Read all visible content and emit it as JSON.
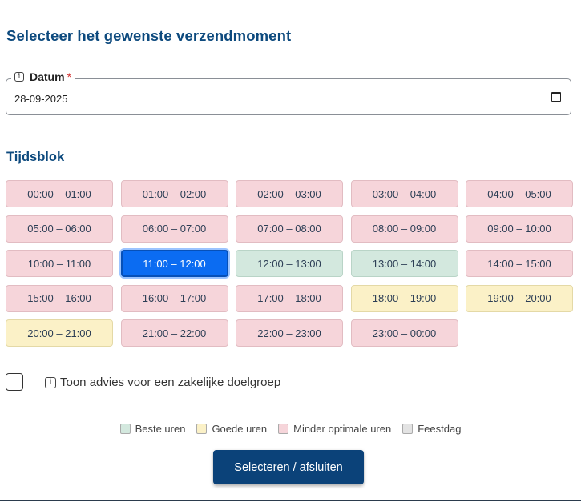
{
  "page_title": "Selecteer het gewenste verzendmoment",
  "date_field": {
    "label": "Datum",
    "required_mark": "*",
    "info_icon": "info-icon",
    "value": "28-09-2025",
    "icon": "calendar-icon"
  },
  "timeblock": {
    "title": "Tijdsblok",
    "slots": [
      {
        "label": "00:00 – 01:00",
        "status": "minder-optimaal"
      },
      {
        "label": "01:00 – 02:00",
        "status": "minder-optimaal"
      },
      {
        "label": "02:00 – 03:00",
        "status": "minder-optimaal"
      },
      {
        "label": "03:00 – 04:00",
        "status": "minder-optimaal"
      },
      {
        "label": "04:00 – 05:00",
        "status": "minder-optimaal"
      },
      {
        "label": "05:00 – 06:00",
        "status": "minder-optimaal"
      },
      {
        "label": "06:00 – 07:00",
        "status": "minder-optimaal"
      },
      {
        "label": "07:00 – 08:00",
        "status": "minder-optimaal"
      },
      {
        "label": "08:00 – 09:00",
        "status": "minder-optimaal"
      },
      {
        "label": "09:00 – 10:00",
        "status": "minder-optimaal"
      },
      {
        "label": "10:00 – 11:00",
        "status": "minder-optimaal"
      },
      {
        "label": "11:00 – 12:00",
        "status": "minder-optimaal",
        "selected": true
      },
      {
        "label": "12:00 – 13:00",
        "status": "beste"
      },
      {
        "label": "13:00 – 14:00",
        "status": "beste"
      },
      {
        "label": "14:00 – 15:00",
        "status": "minder-optimaal"
      },
      {
        "label": "15:00 – 16:00",
        "status": "minder-optimaal"
      },
      {
        "label": "16:00 – 17:00",
        "status": "minder-optimaal"
      },
      {
        "label": "17:00 – 18:00",
        "status": "minder-optimaal"
      },
      {
        "label": "18:00 – 19:00",
        "status": "goede"
      },
      {
        "label": "19:00 – 20:00",
        "status": "goede"
      },
      {
        "label": "20:00 – 21:00",
        "status": "goede"
      },
      {
        "label": "21:00 – 22:00",
        "status": "minder-optimaal"
      },
      {
        "label": "22:00 – 23:00",
        "status": "minder-optimaal"
      },
      {
        "label": "23:00 – 00:00",
        "status": "minder-optimaal"
      }
    ]
  },
  "business_advice": {
    "label": "Toon advies voor een zakelijke doelgroep",
    "checked": false,
    "info_icon": "info-icon"
  },
  "legend": [
    {
      "label": "Beste uren",
      "color": "#d3e8de"
    },
    {
      "label": "Goede uren",
      "color": "#fbf1c7"
    },
    {
      "label": "Minder optimale uren",
      "color": "#f6d5da"
    },
    {
      "label": "Feestdag",
      "color": "#e3e3e3"
    }
  ],
  "submit_label": "Selecteren / afsluiten",
  "colors": {
    "accent": "#0d4a7e",
    "button": "#0b4279",
    "selected": "#0b6cf2"
  }
}
